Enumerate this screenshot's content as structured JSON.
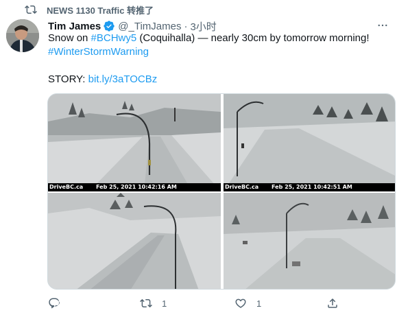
{
  "retweet_context": {
    "text": "NEWS 1130 Traffic 转推了",
    "icon": "retweet-icon"
  },
  "tweet": {
    "author_name": "Tim James",
    "verified_icon": "verified-badge-icon",
    "handle": "@_TimJames",
    "separator": "·",
    "time": "3小时",
    "text": {
      "line1_prefix": "Snow on ",
      "hashtag1": "#BCHwy5",
      "line1_suffix": " (Coquihalla) — nearly 30cm by tomorrow morning!",
      "hashtag2": "#WinterStormWarning",
      "story_label": "STORY: ",
      "story_link": "bit.ly/3aTOCBz"
    }
  },
  "media": {
    "cameras": [
      {
        "source": "DriveBC.ca",
        "timestamp": "Feb 25, 2021 10:42:16 AM"
      },
      {
        "source": "DriveBC.ca",
        "timestamp": "Feb 25, 2021 10:42:51 AM"
      }
    ]
  },
  "actions": {
    "reply": {
      "icon": "reply-icon"
    },
    "retweet": {
      "icon": "retweet-icon",
      "count": "1"
    },
    "like": {
      "icon": "heart-icon",
      "count": "1"
    },
    "share": {
      "icon": "share-icon"
    }
  },
  "colors": {
    "link": "#1d9bf0",
    "secondary_text": "#536471",
    "primary_text": "#0f1419",
    "verified": "#1d9bf0"
  }
}
